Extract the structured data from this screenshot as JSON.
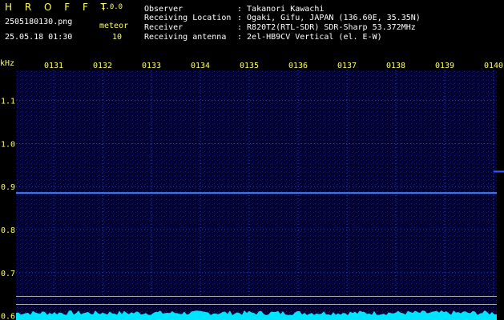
{
  "app": {
    "name": "H R O F F T",
    "version": "1.0.0"
  },
  "file": {
    "name": "2505180130.png",
    "timestamp": "25.05.18 01:30"
  },
  "meteor": {
    "label": "meteor",
    "count": "10"
  },
  "info": [
    {
      "key": "Observer",
      "value": ": Takanori Kawachi"
    },
    {
      "key": "Receiving Location",
      "value": ": Ogaki, Gifu, JAPAN (136.60E, 35.35N)"
    },
    {
      "key": "Receiver",
      "value": ": R820T2(RTL-SDR) SDR-Sharp 53.372MHz"
    },
    {
      "key": "Receiving antenna",
      "value": ": 2el-HB9CV Vertical (el. E-W)"
    }
  ],
  "chart_data": {
    "type": "heatmap",
    "ylabel": "kHz",
    "x_ticks": [
      "0131",
      "0132",
      "0133",
      "0134",
      "0135",
      "0136",
      "0137",
      "0138",
      "0139",
      "0140"
    ],
    "y_ticks": [
      {
        "value": 1.1,
        "label": "1.1"
      },
      {
        "value": 1.0,
        "label": "1.0"
      },
      {
        "value": 0.9,
        "label": "0.9"
      },
      {
        "value": 0.8,
        "label": "0.8"
      },
      {
        "value": 0.7,
        "label": "0.7"
      },
      {
        "value": 0.6,
        "label": "0.6"
      }
    ],
    "ylim": [
      0.59,
      1.17
    ],
    "carrier_khz": 0.885,
    "meteor_trail": {
      "from": [
        0.94,
        0.935
      ],
      "to": [
        0.9562,
        0.885
      ]
    },
    "colors": {
      "background": "#000033",
      "grid": "#2244aa",
      "carrier": "#4488ff",
      "label": "#ffff66"
    }
  }
}
